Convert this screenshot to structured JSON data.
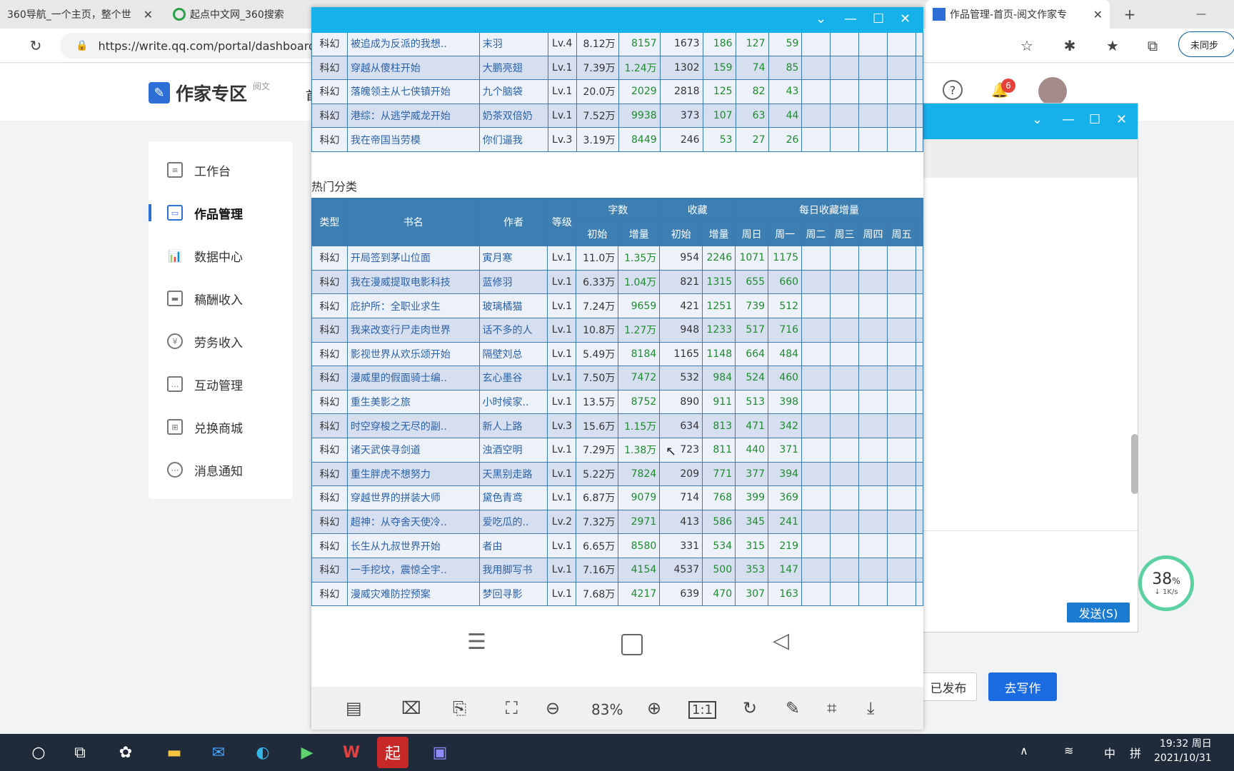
{
  "browser": {
    "tabs": [
      {
        "title": "360导航_一个主页，整个世"
      },
      {
        "title": "起点中文网_360搜索"
      },
      {
        "title": "作品管理-首页-阅文作家专"
      }
    ],
    "url": "https://write.qq.com/portal/dashboard",
    "sync_label": "未同步"
  },
  "site": {
    "logo_text": "作家专区",
    "logo_sub": "阅文",
    "notif_count": "6",
    "nav_partial": "首"
  },
  "sidebar": {
    "items": [
      {
        "label": "工作台"
      },
      {
        "label": "作品管理"
      },
      {
        "label": "数据中心"
      },
      {
        "label": "稿酬收入"
      },
      {
        "label": "劳务收入"
      },
      {
        "label": "互动管理"
      },
      {
        "label": "兑换商城"
      },
      {
        "label": "消息通知"
      }
    ]
  },
  "actions": {
    "published": "已发布",
    "write": "去写作"
  },
  "chat": {
    "send": "发送(S)"
  },
  "speed": {
    "percent": "38",
    "unit": "%",
    "rate": "1K/s"
  },
  "viewer": {
    "section_label": "热门分类",
    "zoom": "83%",
    "headers": {
      "type": "类型",
      "name": "书名",
      "author": "作者",
      "level": "等级",
      "words": "字数",
      "fav": "收藏",
      "daily": "每日收藏增量",
      "init": "初始",
      "inc": "增量",
      "days": [
        "周日",
        "周一",
        "周二",
        "周三",
        "周四",
        "周五"
      ]
    },
    "top_rows": [
      [
        "科幻",
        "被追成为反派的我想..",
        "末羽",
        "Lv.4",
        "8.12万",
        "8157",
        "1673",
        "186",
        "127",
        "59"
      ],
      [
        "科幻",
        "穿越从傻柱开始",
        "大鹏亮翅",
        "Lv.1",
        "7.39万",
        "1.24万",
        "1302",
        "159",
        "74",
        "85"
      ],
      [
        "科幻",
        "落魄领主从七侠镇开始",
        "九个脑袋",
        "Lv.1",
        "20.0万",
        "2029",
        "2818",
        "125",
        "82",
        "43"
      ],
      [
        "科幻",
        "港综：从逃学威龙开始",
        "奶茶双倍奶",
        "Lv.1",
        "7.52万",
        "9938",
        "373",
        "107",
        "63",
        "44"
      ],
      [
        "科幻",
        "我在帝国当劳模",
        "你们逼我",
        "Lv.3",
        "3.19万",
        "8449",
        "246",
        "53",
        "27",
        "26"
      ]
    ],
    "rows": [
      [
        "科幻",
        "开局签到茅山位面",
        "寅月寒",
        "Lv.1",
        "11.0万",
        "1.35万",
        "954",
        "2246",
        "1071",
        "1175"
      ],
      [
        "科幻",
        "我在漫威提取电影科技",
        "蓝修羽",
        "Lv.1",
        "6.33万",
        "1.04万",
        "821",
        "1315",
        "655",
        "660"
      ],
      [
        "科幻",
        "庇护所：全职业求生",
        "玻璃橘猫",
        "Lv.1",
        "7.24万",
        "9659",
        "421",
        "1251",
        "739",
        "512"
      ],
      [
        "科幻",
        "我来改变行尸走肉世界",
        "话不多的人",
        "Lv.1",
        "10.8万",
        "1.27万",
        "948",
        "1233",
        "517",
        "716"
      ],
      [
        "科幻",
        "影视世界从欢乐颂开始",
        "隔壁刘总",
        "Lv.1",
        "5.49万",
        "8184",
        "1165",
        "1148",
        "664",
        "484"
      ],
      [
        "科幻",
        "漫威里的假面骑士编..",
        "玄心墨谷",
        "Lv.1",
        "7.50万",
        "7472",
        "532",
        "984",
        "524",
        "460"
      ],
      [
        "科幻",
        "重生美影之旅",
        "小时候家..",
        "Lv.1",
        "13.5万",
        "8752",
        "890",
        "911",
        "513",
        "398"
      ],
      [
        "科幻",
        "时空穿梭之无尽的副..",
        "新人上路",
        "Lv.3",
        "15.6万",
        "1.15万",
        "634",
        "813",
        "471",
        "342"
      ],
      [
        "科幻",
        "诸天武侠寻剑道",
        "浊酒空明",
        "Lv.1",
        "7.29万",
        "1.38万",
        "723",
        "811",
        "440",
        "371"
      ],
      [
        "科幻",
        "重生胖虎不想努力",
        "天黑别走路",
        "Lv.1",
        "5.22万",
        "7824",
        "209",
        "771",
        "377",
        "394"
      ],
      [
        "科幻",
        "穿越世界的拼装大师",
        "黛色青鸢",
        "Lv.1",
        "6.87万",
        "9079",
        "714",
        "768",
        "399",
        "369"
      ],
      [
        "科幻",
        "超神：从夺舍天使冷..",
        "爱吃瓜的..",
        "Lv.2",
        "7.32万",
        "2971",
        "413",
        "586",
        "345",
        "241"
      ],
      [
        "科幻",
        "长生从九叔世界开始",
        "者由",
        "Lv.1",
        "6.65万",
        "8580",
        "331",
        "534",
        "315",
        "219"
      ],
      [
        "科幻",
        "一手挖坟，震惊全宇..",
        "我用脚写书",
        "Lv.1",
        "7.16万",
        "4154",
        "4537",
        "500",
        "353",
        "147"
      ],
      [
        "科幻",
        "漫威灾难防控预案",
        "梦回寻影",
        "Lv.1",
        "7.68万",
        "4217",
        "639",
        "470",
        "307",
        "163"
      ]
    ]
  },
  "taskbar": {
    "time": "19:32 周日",
    "date": "2021/10/31",
    "ime": "中",
    "ime2": "拼"
  }
}
